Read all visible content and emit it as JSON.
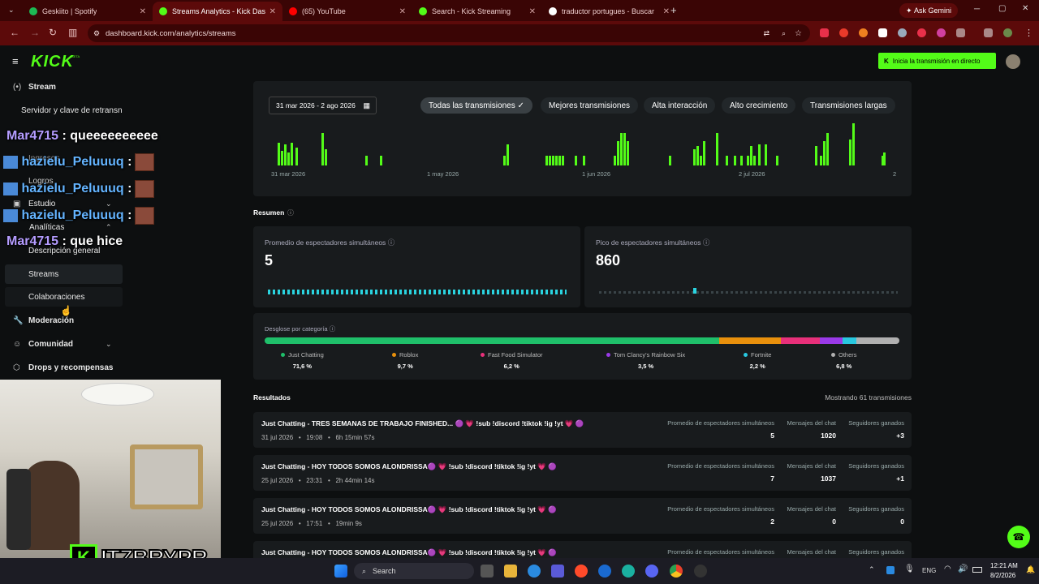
{
  "browser": {
    "tabs": [
      {
        "label": "Geskiito | Spotify",
        "color": "#1db954"
      },
      {
        "label": "Streams Analytics - Kick Dashb",
        "color": "#53fc18",
        "active": true
      },
      {
        "label": "(65) YouTube",
        "color": "#ff0000"
      },
      {
        "label": "Search - Kick Streaming",
        "color": "#53fc18"
      },
      {
        "label": "traductor portugues - Buscar co",
        "color": "#ffffff"
      }
    ],
    "ask_gemini": "Ask Gemini",
    "url": "dashboard.kick.com/analytics/streams"
  },
  "header": {
    "logo": "KICK",
    "beta": "BETA",
    "go_live": "Inicia la transmisión en directo"
  },
  "sidebar": {
    "stream": "Stream",
    "server_key": "Servidor y clave de retransn",
    "ingresos": "Ingresos",
    "logros": "Logros",
    "estudio": "Estudio",
    "analiticas": "Analíticas",
    "descripcion": "Descripción general",
    "streams": "Streams",
    "colaboraciones": "Colaboraciones",
    "moderacion": "Moderación",
    "comunidad": "Comunidad",
    "drops": "Drops y recompensas"
  },
  "chat_overlay": [
    {
      "user": "Mar4715",
      "msg": ": queeeeeeeeee"
    },
    {
      "user": "hazielu_Peluuuq",
      "msg": ":"
    },
    {
      "user": "hazielu_Peluuuq",
      "msg": ":"
    },
    {
      "user": "hazielu_Peluuuq",
      "msg": ":"
    },
    {
      "user": "Mar4715",
      "msg": ": que hice"
    }
  ],
  "filters": {
    "date_range": "31 mar 2026 - 2 ago 2026",
    "chips": [
      "Todas las transmisiones",
      "Mejores transmisiones",
      "Alta interacción",
      "Alto crecimiento",
      "Transmisiones largas"
    ]
  },
  "timeline": {
    "axis_labels": [
      "31 mar 2026",
      "1 may 2026",
      "1 jun 2026",
      "2 jul 2026",
      "2"
    ]
  },
  "summary": {
    "title": "Resumen",
    "avg_label": "Promedio de espectadores simultáneos",
    "avg_value": "5",
    "peak_label": "Pico de espectadores simultáneos",
    "peak_value": "860",
    "breakdown_title": "Desglose por categoría",
    "categories": [
      {
        "name": "Just Chatting",
        "pct": "71,6 %",
        "color": "#1fbf6a"
      },
      {
        "name": "Roblox",
        "pct": "9,7 %",
        "color": "#e8900c"
      },
      {
        "name": "Fast Food Simulator",
        "pct": "6,2 %",
        "color": "#e8307a"
      },
      {
        "name": "Tom Clancy's Rainbow Six",
        "pct": "3,5 %",
        "color": "#9a3ae8"
      },
      {
        "name": "Fortnite",
        "pct": "2,2 %",
        "color": "#28c8e0"
      },
      {
        "name": "Others",
        "pct": "6,8 %",
        "color": "#b0b0b0"
      }
    ]
  },
  "results": {
    "title": "Resultados",
    "count": "Mostrando 61 transmisiones",
    "col_avg": "Promedio de espectadores simultáneos",
    "col_chat": "Mensajes del chat",
    "col_followers": "Seguidores ganados",
    "rows": [
      {
        "title": "Just Chatting - TRES SEMANAS DE TRABAJO FINISHED... 🟣 💗 !sub !discord !tiktok !ig !yt 💗 🟣",
        "date": "31 jul 2026",
        "time": "19:08",
        "duration": "6h 15min 57s",
        "avg": "5",
        "chat": "1020",
        "followers": "+3"
      },
      {
        "title": "Just Chatting - HOY TODOS SOMOS ALONDRISSA🟣 💗 !sub !discord !tiktok !ig !yt 💗 🟣",
        "date": "25 jul 2026",
        "time": "23:31",
        "duration": "2h 44min 14s",
        "avg": "7",
        "chat": "1037",
        "followers": "+1"
      },
      {
        "title": "Just Chatting - HOY TODOS SOMOS ALONDRISSA🟣 💗 !sub !discord !tiktok !ig !yt 💗 🟣",
        "date": "25 jul 2026",
        "time": "17:51",
        "duration": "19min 9s",
        "avg": "2",
        "chat": "0",
        "followers": "0"
      },
      {
        "title": "Just Chatting - HOY TODOS SOMOS ALONDRISSA🟣 💗 !sub !discord !tiktok !ig !yt 💗 🟣",
        "date": "",
        "time": "",
        "duration": "",
        "avg": "",
        "chat": "",
        "followers": ""
      }
    ]
  },
  "webcam": {
    "brand": "ITZBRYPR"
  },
  "taskbar": {
    "search": "Search",
    "lang": "ENG",
    "time": "12:21 AM",
    "date": "8/2/2026"
  }
}
